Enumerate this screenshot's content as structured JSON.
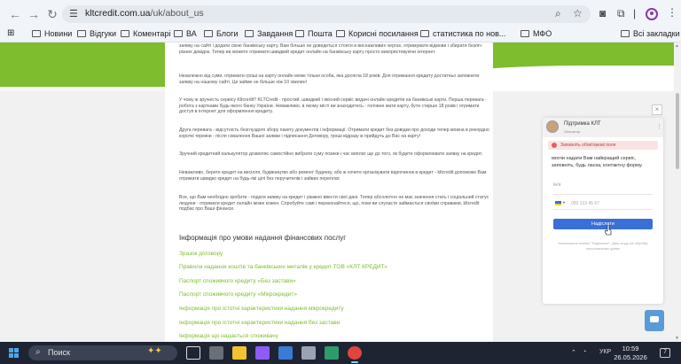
{
  "browser": {
    "url_host": "kltcredit.com.ua",
    "url_path": "/uk/about_us",
    "bookmarks": [
      "Новини",
      "Відгуки",
      "Коментарі",
      "ВА",
      "Блоги",
      "Завдання",
      "Пошта",
      "Корисні посилання",
      "статистика по нов...",
      "МФО"
    ],
    "all_bookmarks": "Всі закладки"
  },
  "article": {
    "paragraphs": [
      "заявку на сайті і додати свою банківську карту. Вам більше не доведеться стояти в виснажливих чергах, отримувати відмови і збирати безліч різних довідок. Тепер ви можете отримати швидкий кредит онлайн на банківську карту просто використовуючи інтернет.",
      "Незалежно від суми, отримати гроші на карту онлайн може тільки особа, яка досягла 18 років. Для отримання кредиту достатньо заповнити заявку на нашому сайті. Це займе не більше ніж 10 хвилин!",
      "У чому ж зручність сервісу Kltcredit? KLTCredit - простий, швидкий і якісний сервіс видачі онлайн кредитів на банківські карти. Перша перевага - робота з картками будь-якого банку України. Неважливо, в якому місті ви знаходитесь - головне мати карту, бути старше 18 років і отримати доступ в інтернет для оформлення кредиту.",
      "Друга перевага - відсутність безглуздого збору пакету документів і інформації. Отримати кредит без довідки про доходи тепер можна в рекордно короткі терміни - після схвалення Вашої заявки і підписання Договору, гроші відразу ж прийдуть до Вас на карту!",
      "Зручний кредитний калькулятор дозволяє самостійно вибрати суму позики і час виплат ще до того, як будете оформлювати заявку на кредит.",
      "Неважливо, берете кредит на весілля, будівництво або ремонт будинку, або ж хочете організувати відпочинок в кредит - kltcredit допоможе Вам отримати швидко кредит на будь-які цілі без поручителів і зайвих переплат.",
      "Все, що Вам необхідно зробити - подати заявку на кредит і уважно ввести свої дані. Тепер абсолютно не має значення стать і соціальний статус людини - отримати кредит онлайн може кожен. Спробуйте самі і переконайтеся, що, поки ви слухаєте займається своїми справами, kltcredit подбає про Ваші фінанси."
    ],
    "section_title": "Інформація про умови надання фінансових послуг",
    "links": [
      "Зразок договору",
      "Правила надання коштів та банківських металів у кредит ТОВ «КЛТ КРЕДИТ»",
      "Паспорт споживчого кредиту «Без застави»",
      "Паспорт споживчого кредиту «Мікрокредит»",
      "Інформація про істотні характеристики надання мікрокредиту",
      "Інформація про істотні характеристики надання без застави",
      "Інформація що надається споживачу"
    ]
  },
  "chat": {
    "close": "×",
    "agent_name": "Підтримка КЛТ",
    "agent_role": "Оператор",
    "alert": "Заповніть обов'язкові поля",
    "message": "могли надати Вам найкращий сервіс, заповніть, будь ласка, контактну форму.",
    "name_label": "Ім'я",
    "phone_placeholder": "050 123 45 67",
    "send_button": "Надіслати",
    "consent": "Натискаючи кнопку \"Надіслати\", Даю згоду на обробку персональних даних"
  },
  "taskbar": {
    "search_label": "Поиск",
    "language": "УКР",
    "time": "10:59",
    "date": "26.05.2026",
    "notifications": "7"
  },
  "colors": {
    "brand_green": "#7dbd2e",
    "chat_button": "#3a6fd8",
    "taskbar": "#1f2433"
  }
}
